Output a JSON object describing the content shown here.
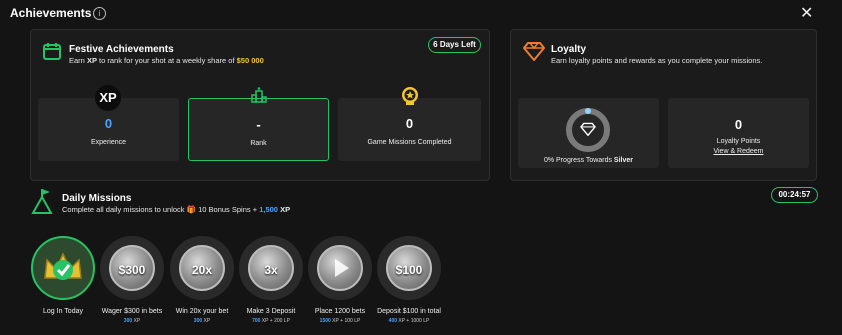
{
  "header": {
    "title": "Achievements",
    "info_icon": "info-icon",
    "close_label": "✕"
  },
  "festive": {
    "title": "Festive Achievements",
    "subtitle_pre": "Earn",
    "subtitle_xp": "XP",
    "subtitle_mid": "to rank for your shot at a weekly share of",
    "prize": "$50 000",
    "days_left": "6 Days Left",
    "cards": [
      {
        "value": "0",
        "label": "Experience",
        "badge": "XP"
      },
      {
        "value": "-",
        "label": "Rank",
        "icon": "podium-icon"
      },
      {
        "value": "0",
        "label": "Game Missions Completed",
        "icon": "medal-icon"
      }
    ]
  },
  "loyalty": {
    "title": "Loyalty",
    "subtitle": "Earn loyalty points and rewards as you complete your missions.",
    "progress_text": "0% Progress Towards",
    "tier": "Silver",
    "progress": 0,
    "points_value": "0",
    "points_label": "Loyalty Points",
    "link": "View & Redeem"
  },
  "daily": {
    "title": "Daily Missions",
    "subtitle_pre": "Complete all daily missions to unlock",
    "bonus": "10 Bonus Spins +",
    "xp_amount": "1,500",
    "xp_label": "XP",
    "timer": "00:24:57",
    "missions": [
      {
        "name": "Log In Today",
        "xp": "",
        "lp": "",
        "coin": ""
      },
      {
        "name": "Wager $300 in bets",
        "xp": "300",
        "lp": "",
        "coin": "$300"
      },
      {
        "name": "Win 20x your bet",
        "xp": "300",
        "lp": "",
        "coin": "20x"
      },
      {
        "name": "Make 3 Deposit",
        "xp": "700",
        "lp": "200 LP",
        "coin": "3x"
      },
      {
        "name": "Place 1200 bets",
        "xp": "1500",
        "lp": "100 LP",
        "coin": ""
      },
      {
        "name": "Deposit $100 in total",
        "xp": "400",
        "lp": "1000 LP",
        "coin": "$100"
      }
    ]
  },
  "colors": {
    "green": "#27c265",
    "blue": "#4ea2ff",
    "gold": "#f3c62b",
    "orange": "#f07a2b"
  }
}
